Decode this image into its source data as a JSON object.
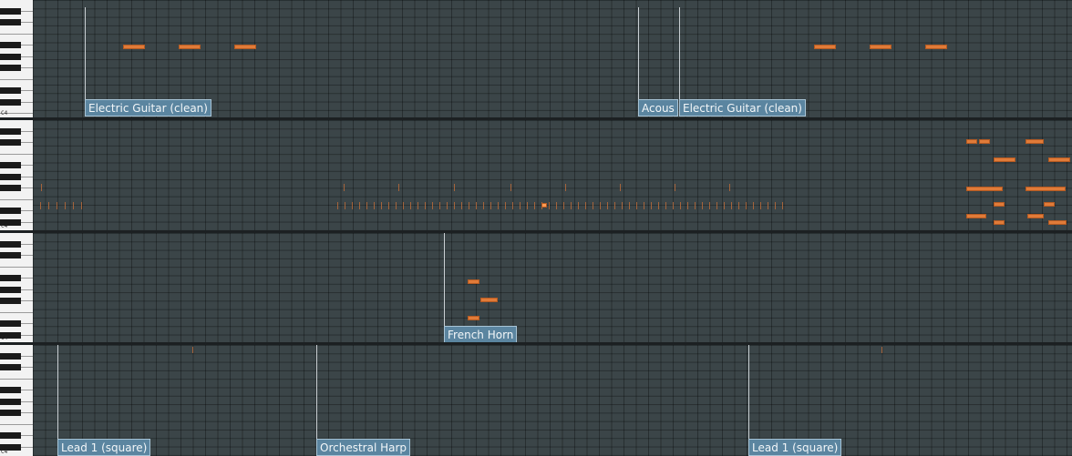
{
  "colors": {
    "grid_bg": "#3b4548",
    "note": "#e07b39",
    "clip_label_bg": "#5b85a0",
    "clip_line": "#c9cfd3"
  },
  "octave_label": "C4",
  "clips": {
    "electric_guitar_1": "Electric Guitar (clean)",
    "acoustic_truncated": "Acous",
    "electric_guitar_2": "Electric Guitar (clean)",
    "french_horn": "French Horn",
    "lead_1": "Lead 1 (square)",
    "orchestral_harp": "Orchestral Harp",
    "lead_2": "Lead 1 (square)"
  }
}
